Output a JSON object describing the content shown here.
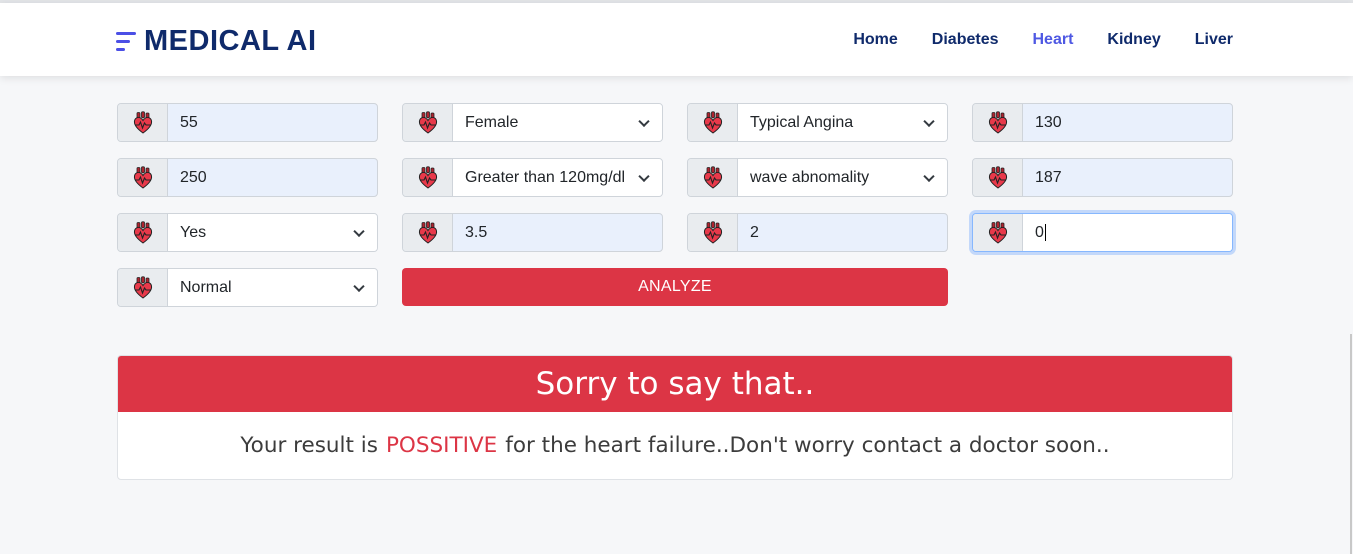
{
  "brand": {
    "name": "MEDICAL AI",
    "icon": "menu-lines-icon"
  },
  "nav": {
    "items": [
      {
        "label": "Home"
      },
      {
        "label": "Diabetes"
      },
      {
        "label": "Heart"
      },
      {
        "label": "Kidney"
      },
      {
        "label": "Liver"
      }
    ],
    "active": "Heart"
  },
  "form": {
    "field_icon": "heart-organ-icon",
    "fields": [
      {
        "type": "input",
        "value": "55"
      },
      {
        "type": "select",
        "value": "Female"
      },
      {
        "type": "select",
        "value": "Typical Angina"
      },
      {
        "type": "input",
        "value": "130"
      },
      {
        "type": "input",
        "value": "250"
      },
      {
        "type": "select",
        "value": "Greater than 120mg/dl"
      },
      {
        "type": "select",
        "value": "wave abnomality"
      },
      {
        "type": "input",
        "value": "187"
      },
      {
        "type": "select",
        "value": "Yes"
      },
      {
        "type": "input",
        "value": "3.5"
      },
      {
        "type": "input",
        "value": "2"
      },
      {
        "type": "input",
        "value": "0",
        "focused": true
      },
      {
        "type": "select",
        "value": "Normal"
      }
    ],
    "analyze_label": "ANALYZE"
  },
  "result": {
    "heading": "Sorry to say that..",
    "message_before": "Your result is",
    "message_highlight": "POSSITIVE",
    "message_after": "for the heart failure..Don't worry contact a doctor soon.."
  },
  "colors": {
    "brand": "#0f2a6b",
    "accent": "#4e58e3",
    "danger": "#dc3545",
    "input_fill": "#e9f0fc"
  }
}
